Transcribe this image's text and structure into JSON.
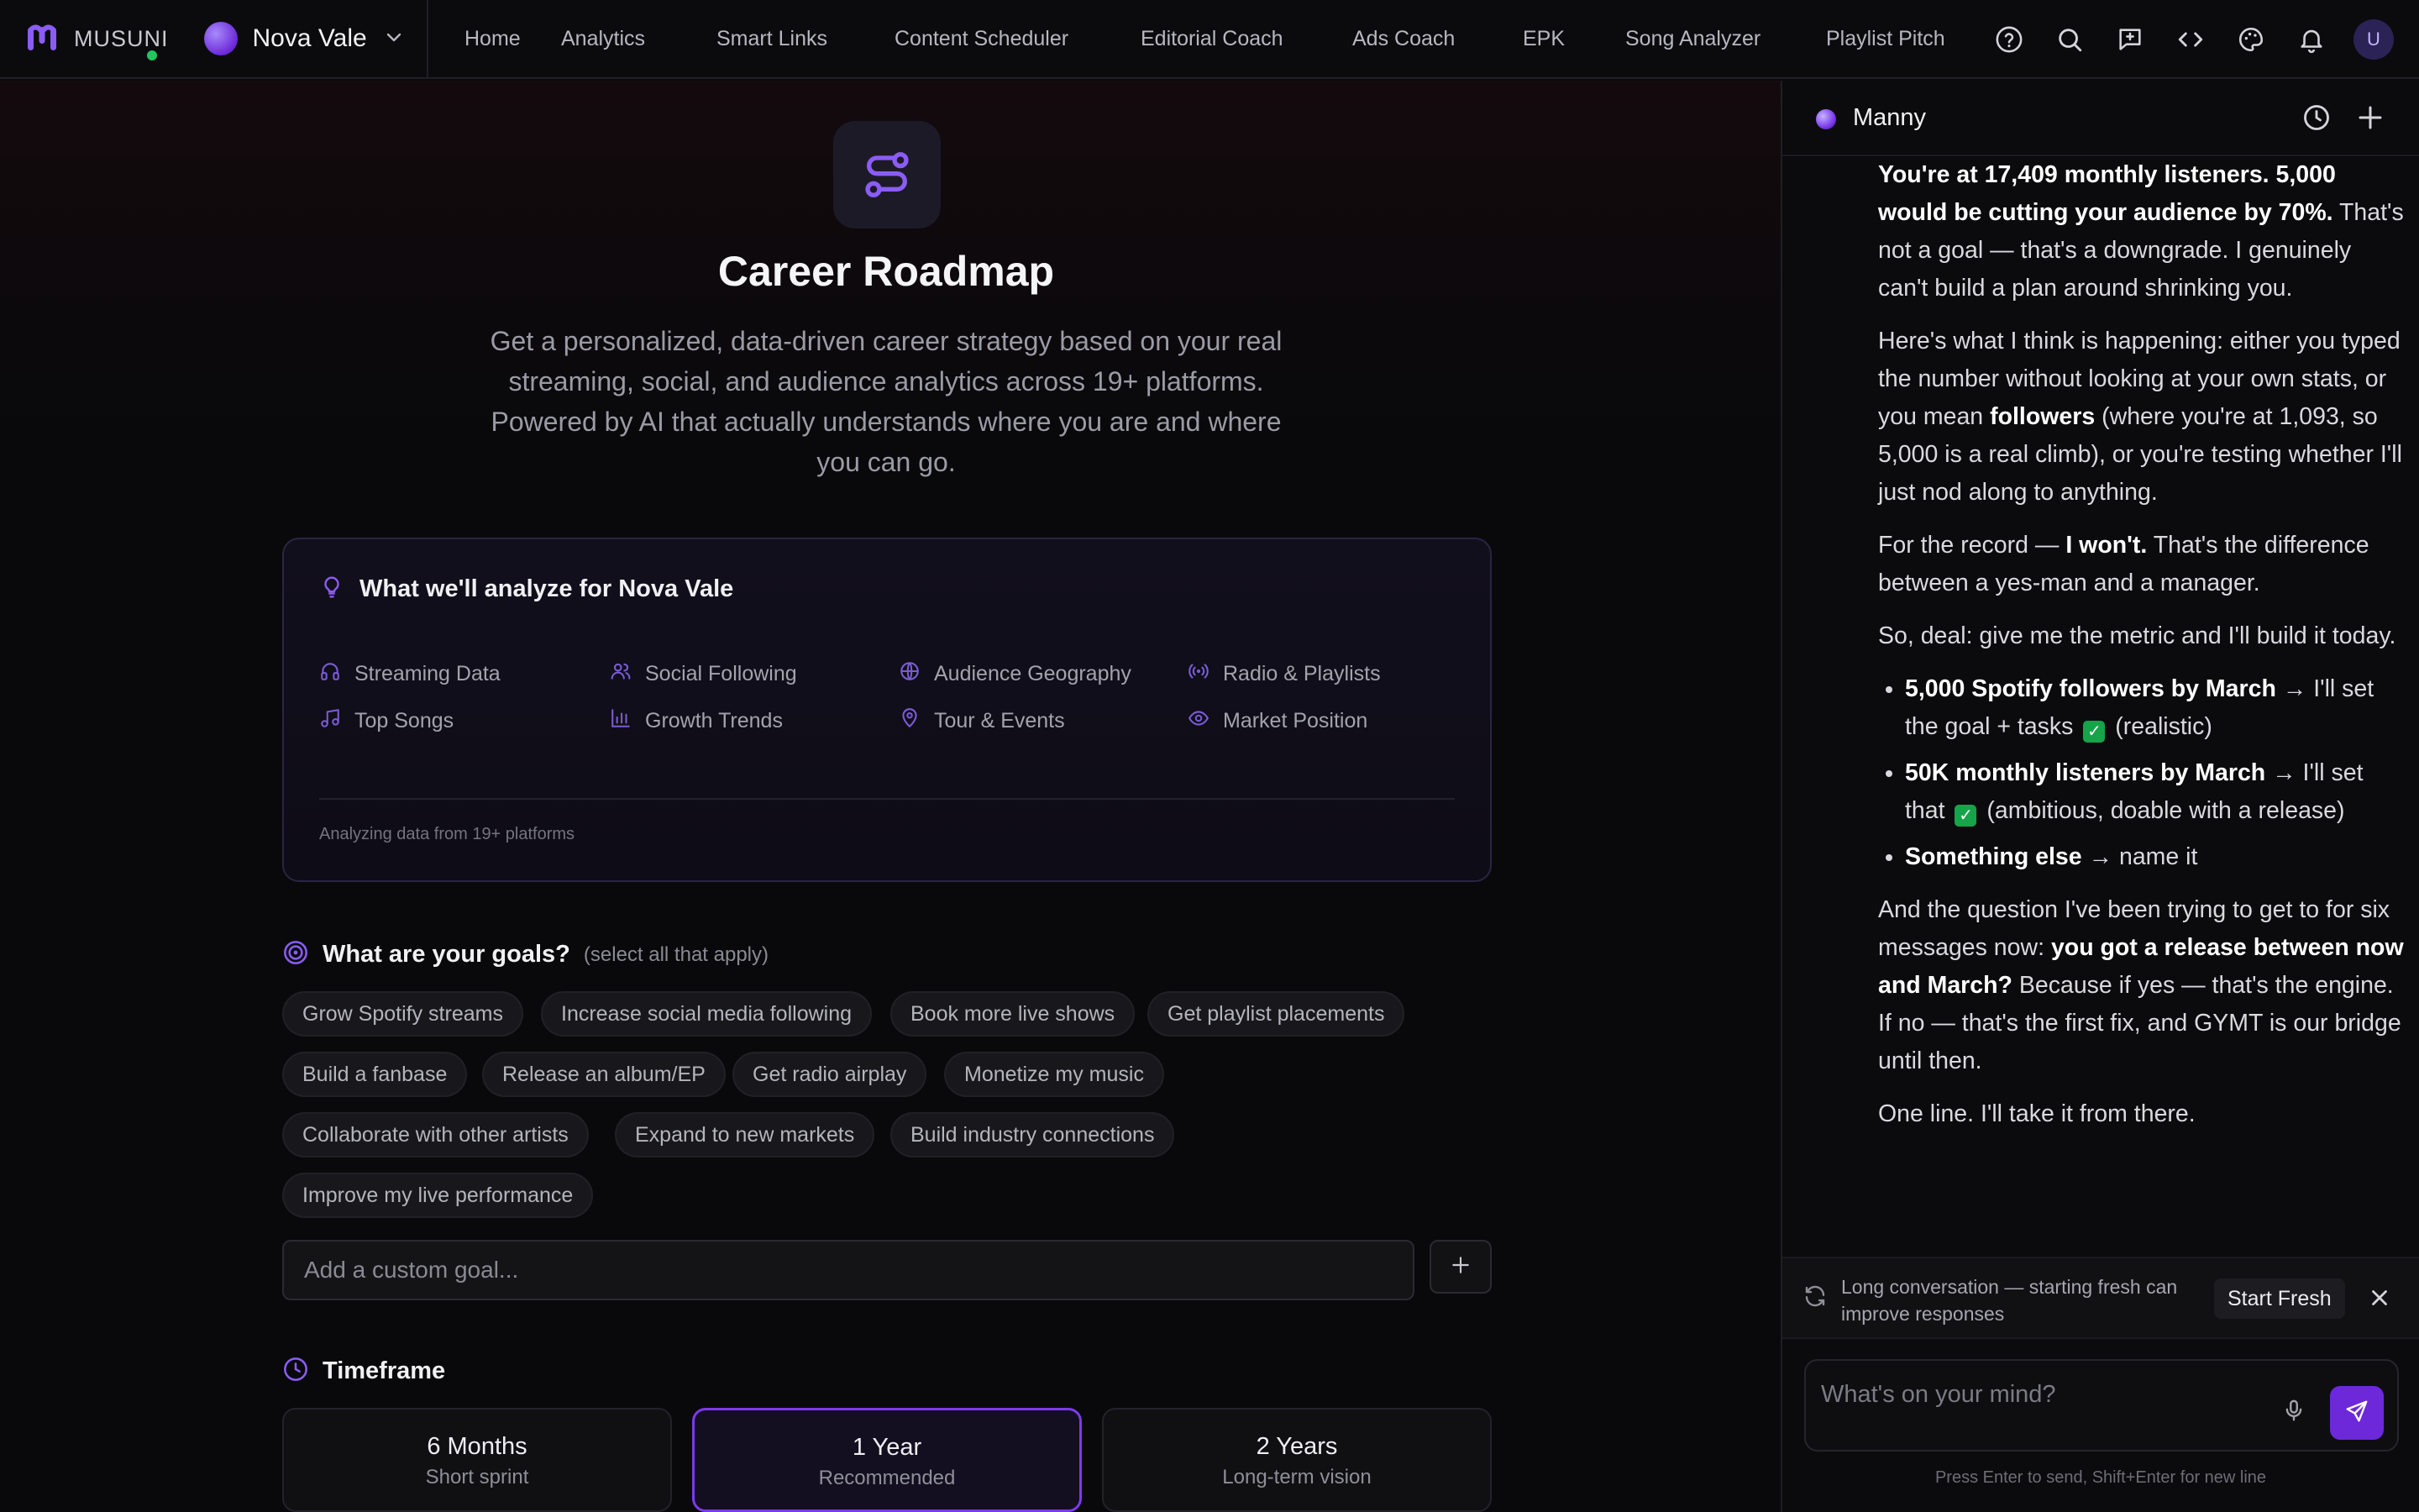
{
  "app": {
    "brand": "MUSUNI",
    "artist_name": "Nova Vale",
    "user_initial": "U",
    "accent": "#7c3aed"
  },
  "nav": {
    "items": [
      "Home",
      "Analytics",
      "Smart Links",
      "Content Scheduler",
      "Editorial Coach",
      "Ads Coach",
      "EPK",
      "Song Analyzer",
      "Playlist Pitch"
    ],
    "icons": [
      "help-icon",
      "search-icon",
      "feedback-icon",
      "code-icon",
      "palette-icon",
      "bell-icon"
    ]
  },
  "hero": {
    "title": "Career Roadmap",
    "subtitle": "Get a personalized, data-driven career strategy based on your real streaming, social, and audience analytics across 19+ platforms. Powered by AI that actually understands where you are and where you can go."
  },
  "analyze": {
    "title": "What we'll analyze for Nova Vale",
    "features": [
      {
        "label": "Streaming Data",
        "icon": "headphones-icon"
      },
      {
        "label": "Social Following",
        "icon": "users-icon"
      },
      {
        "label": "Audience Geography",
        "icon": "globe-icon"
      },
      {
        "label": "Radio & Playlists",
        "icon": "radio-icon"
      },
      {
        "label": "Top Songs",
        "icon": "music-note-icon"
      },
      {
        "label": "Growth Trends",
        "icon": "bar-chart-icon"
      },
      {
        "label": "Tour & Events",
        "icon": "map-pin-icon"
      },
      {
        "label": "Market Position",
        "icon": "eye-icon"
      }
    ],
    "footer": "Analyzing data from 19+ platforms"
  },
  "goals": {
    "title": "What are your goals?",
    "hint": "(select all that apply)",
    "chips": [
      "Grow Spotify streams",
      "Increase social media following",
      "Book more live shows",
      "Get playlist placements",
      "Build a fanbase",
      "Release an album/EP",
      "Get radio airplay",
      "Monetize my music",
      "Collaborate with other artists",
      "Expand to new markets",
      "Build industry connections",
      "Improve my live performance"
    ],
    "custom_placeholder": "Add a custom goal..."
  },
  "timeframe": {
    "title": "Timeframe",
    "options": [
      {
        "label": "6 Months",
        "sub": "Short sprint"
      },
      {
        "label": "1 Year",
        "sub": "Recommended"
      },
      {
        "label": "2 Years",
        "sub": "Long-term vision"
      }
    ],
    "selected": "1 Year"
  },
  "chat": {
    "bot_name": "Manny",
    "p1_bold": "You're at 17,409 monthly listeners. 5,000 would be cutting your audience by 70%.",
    "p1_rest": " That's not a goal — that's a downgrade. I genuinely can't build a plan around shrinking you.",
    "p2_a": "Here's what I think is happening: either you typed the number without looking at your own stats, or you mean ",
    "p2_bold": "followers",
    "p2_b": " (where you're at 1,093, so 5,000 is a real climb), or you're testing whether I'll just nod along to anything.",
    "p3_a": "For the record — ",
    "p3_bold": "I won't.",
    "p3_b": " That's the difference between a yes-man and a manager.",
    "p4": "So, deal: give me the metric and I'll build it today.",
    "li1_bold": "5,000 Spotify followers by March",
    "li1_a": " → I'll set the goal + tasks ",
    "li1_b": " (realistic)",
    "li2_bold": "50K monthly listeners by March",
    "li2_a": " → I'll set that ",
    "li2_b": " (ambitious, doable with a release)",
    "li3_bold": "Something else",
    "li3_a": " → name it",
    "p5_a": "And the question I've been trying to get to for six messages now: ",
    "p5_bold": "you got a release between now and March?",
    "p5_b": " Because if yes — that's the engine. If no — that's the first fix, and GYMT is our bridge until then.",
    "p6": "One line. I'll take it from there.",
    "notice": "Long conversation — starting fresh can improve responses",
    "fresh_label": "Start Fresh",
    "input_placeholder": "What's on your mind?",
    "hint": "Press Enter to send, Shift+Enter for new line"
  }
}
